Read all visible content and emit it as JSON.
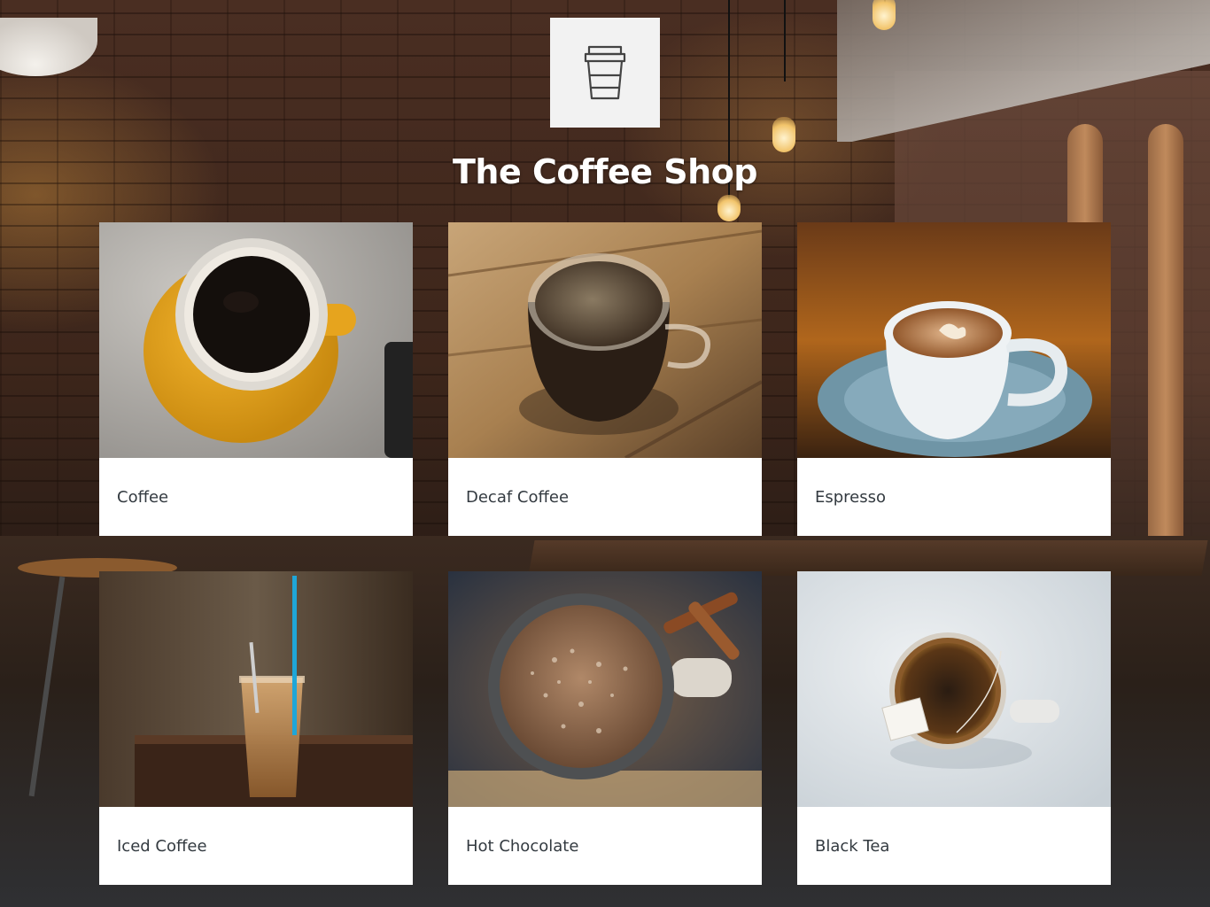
{
  "app": {
    "title": "The Coffee Shop",
    "logo_icon": "coffee-cup-icon"
  },
  "menu": {
    "items": [
      {
        "label": "Coffee",
        "image": "coffee-cup-yellow-saucer"
      },
      {
        "label": "Decaf Coffee",
        "image": "glass-mug-on-wood"
      },
      {
        "label": "Espresso",
        "image": "white-cup-blue-saucer"
      },
      {
        "label": "Iced Coffee",
        "image": "iced-coffee-glass-straw"
      },
      {
        "label": "Hot Chocolate",
        "image": "mug-hot-chocolate"
      },
      {
        "label": "Black Tea",
        "image": "tea-cup-with-teabag"
      }
    ]
  },
  "colors": {
    "card_background": "#ffffff",
    "label_text": "#333a40",
    "title_text": "#ffffff",
    "logo_background": "#f2f2f2"
  }
}
